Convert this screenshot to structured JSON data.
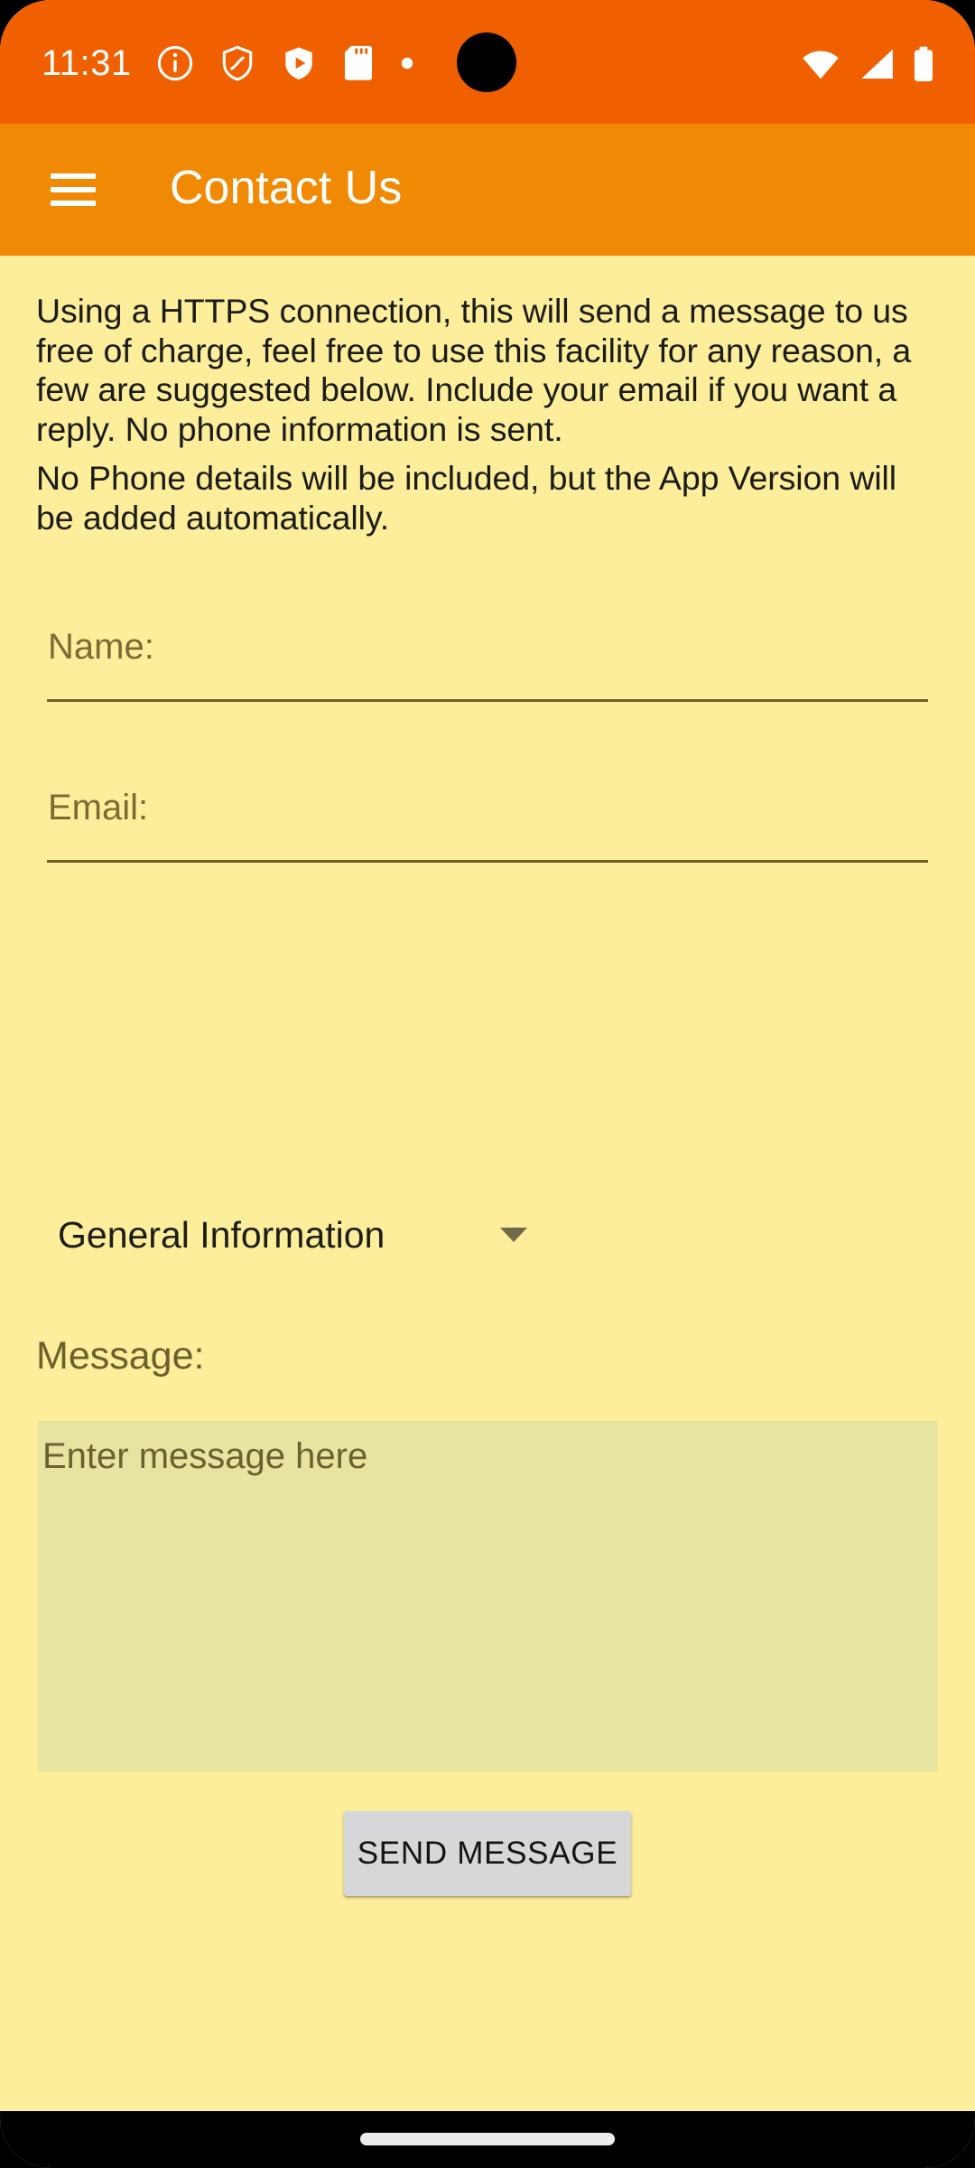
{
  "status_bar": {
    "time": "11:31",
    "background_color": "#F06000",
    "left_icons": [
      {
        "name": "info-circle-icon"
      },
      {
        "name": "shield-outline-icon"
      },
      {
        "name": "shield-play-icon"
      },
      {
        "name": "sd-card-icon"
      },
      {
        "name": "dot-icon"
      }
    ],
    "right_icons": [
      {
        "name": "wifi-icon"
      },
      {
        "name": "cellular-signal-icon"
      },
      {
        "name": "battery-full-icon"
      }
    ]
  },
  "app_bar": {
    "title": "Contact Us",
    "menu_icon": "hamburger-menu-icon",
    "background_color": "#F08A04",
    "title_color": "#FFFFFF"
  },
  "content": {
    "background_color": "#FCEE9A",
    "intro_paragraph": "Using a HTTPS connection, this will send a message to us free of charge, feel free to use this facility for any reason, a few are suggested below. Include your email if you want a reply. No phone information is sent.",
    "note_paragraph": "No Phone details will be included, but the App Version will be added automatically."
  },
  "form": {
    "name_field": {
      "label": "Name:",
      "placeholder": "Name:",
      "value": "",
      "underline_color": "#6E6126"
    },
    "email_field": {
      "label": "Email:",
      "placeholder": "Email:",
      "value": "",
      "underline_color": "#6E6126"
    },
    "category_spinner": {
      "selected": "General Information",
      "caret_icon": "chevron-down-icon"
    },
    "message_field": {
      "label": "Message:",
      "placeholder": "Enter message here",
      "value": "",
      "background_color": "#E7E3A0"
    },
    "send_button": {
      "label": "SEND MESSAGE",
      "background_color": "#D5D7D8"
    }
  },
  "nav_bar": {
    "gesture_pill": "home-gesture-pill",
    "background_color": "#000000"
  }
}
